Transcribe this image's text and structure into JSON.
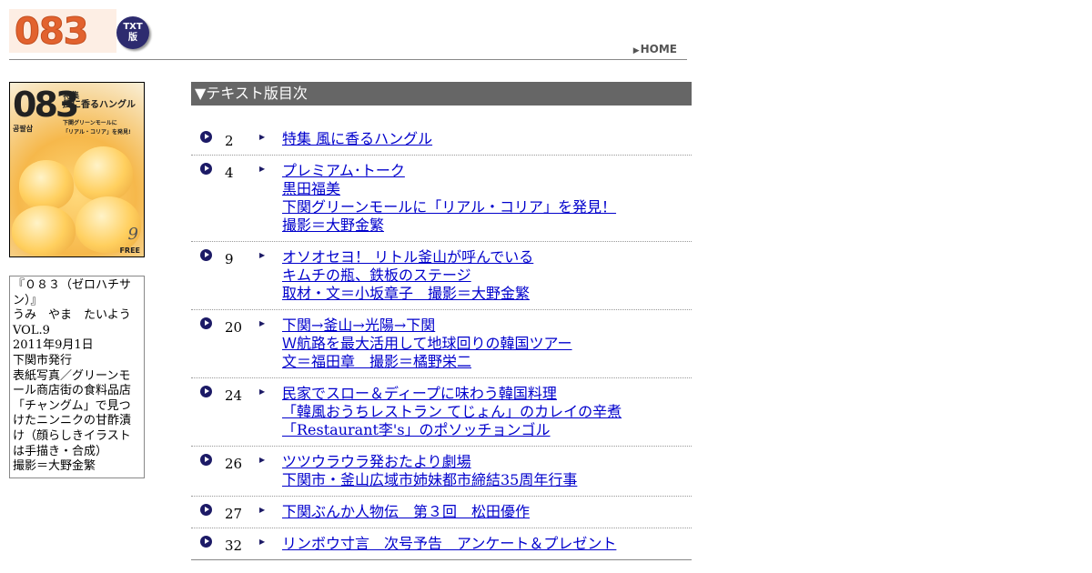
{
  "header": {
    "logo_text": "083",
    "badge_line1": "TXT",
    "badge_line2": "版",
    "home_label": "HOME",
    "home_arrow": "▶"
  },
  "cover": {
    "number": "083",
    "feature_label": "特集",
    "feature_title": "風に香るハングル",
    "feature_sub": "下関グリーンモールに",
    "feature_sub2": "「リアル・コリア」を発見!",
    "korean_tag": "공팔삼",
    "vol": "9",
    "free": "FREE"
  },
  "info": {
    "lines": [
      "『０８３（ゼロハチサン）』",
      "うみ　やま　たいよう",
      "VOL.9",
      "2011年9月1日",
      "下関市発行",
      "表紙写真／グリーンモール商店街の食料品店「チャングム」で見つけたニンニクの甘酢漬け（顔らしきイラストは手描き・合成）",
      "撮影＝大野金繁"
    ]
  },
  "toc": {
    "header": "▼テキスト版目次",
    "bullet": "▶",
    "rows": [
      {
        "page": "2",
        "links": [
          "特集 風に香るハングル"
        ]
      },
      {
        "page": "4",
        "links": [
          "プレミアム･トーク",
          "黒田福美",
          "下関グリーンモールに「リアル・コリア」を発見！",
          "撮影＝大野金繁"
        ]
      },
      {
        "page": "9",
        "links": [
          "オソオセヨ！ リトル釜山が呼んでいる",
          "キムチの瓶、鉄板のステージ",
          "取材・文＝小坂章子　撮影＝大野金繁"
        ]
      },
      {
        "page": "20",
        "links": [
          "下関→釜山→光陽→下関",
          "Ｗ航路を最大活用して地球回りの韓国ツアー",
          "文＝福田章　撮影＝橘野栄二"
        ]
      },
      {
        "page": "24",
        "links": [
          "民家でスロー＆ディープに味わう韓国料理",
          "「韓風おうちレストラン てじょん」のカレイの辛煮",
          "「Restaurant李's」のポソッチョンゴル"
        ]
      },
      {
        "page": "26",
        "links": [
          "ツツウラウラ発おたより劇場",
          "下関市・釜山広域市姉妹都市締結35周年行事"
        ]
      },
      {
        "page": "27",
        "links": [
          "下関ぶんか人物伝　第３回　松田優作"
        ]
      },
      {
        "page": "32",
        "links": [
          "リンボウ寸言　次号予告　アンケート＆プレゼント"
        ]
      }
    ]
  },
  "colors": {
    "logo_orange": "#e2622e",
    "badge_navy": "#2d2b6f",
    "toc_header_bg": "#666666",
    "link_blue": "#0000cc"
  }
}
